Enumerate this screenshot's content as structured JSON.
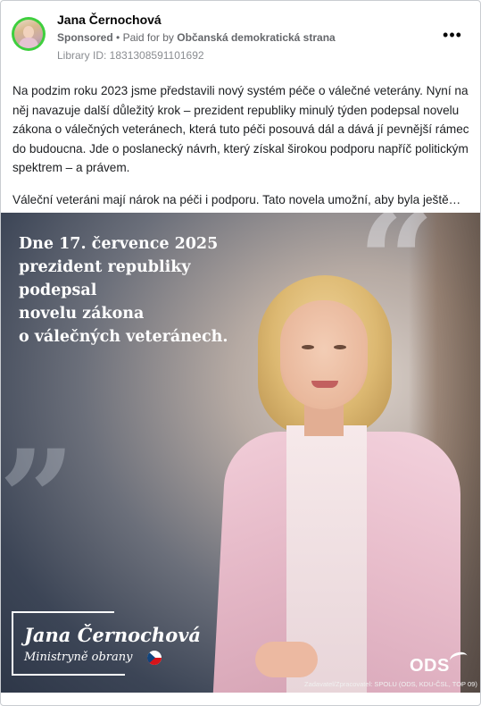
{
  "advertiser": {
    "name": "Jana Černochová",
    "sponsored": "Sponsored",
    "paid_prefix": "Paid for by",
    "payer": "Občanská demokratická strana",
    "library_id": "Library ID: 1831308591101692"
  },
  "post": {
    "paragraph1": "Na podzim roku 2023 jsme představili nový systém péče o válečné veterány. Nyní na něj navazuje další důležitý krok – prezident republiky minulý týden podepsal novelu zákona o válečných veteránech, která tuto péči posouvá dál a dává jí pevnější rámec do budoucna. Jde o poslanecký návrh, který získal širokou podporu napříč politickým spektrem – a právem.",
    "paragraph2": "Váleční veteráni mají nárok na péči i podporu. Tato novela umožní, aby byla ještě…"
  },
  "creative": {
    "headline_lines": [
      "Dne 17. července 2025",
      "prezident republiky",
      "podepsal",
      "novelu zákona",
      "o válečných veteránech."
    ],
    "person_name": "Jana Černochová",
    "person_role": "Ministryně obrany",
    "party_logo": "ODS",
    "imprint": "Zadavatel/Zpracovatel: SPOLU (ODS, KDU-ČSL, TOP 09)"
  },
  "icons": {
    "more": "more-horizontal-icon",
    "flag": "czech-flag-icon"
  }
}
